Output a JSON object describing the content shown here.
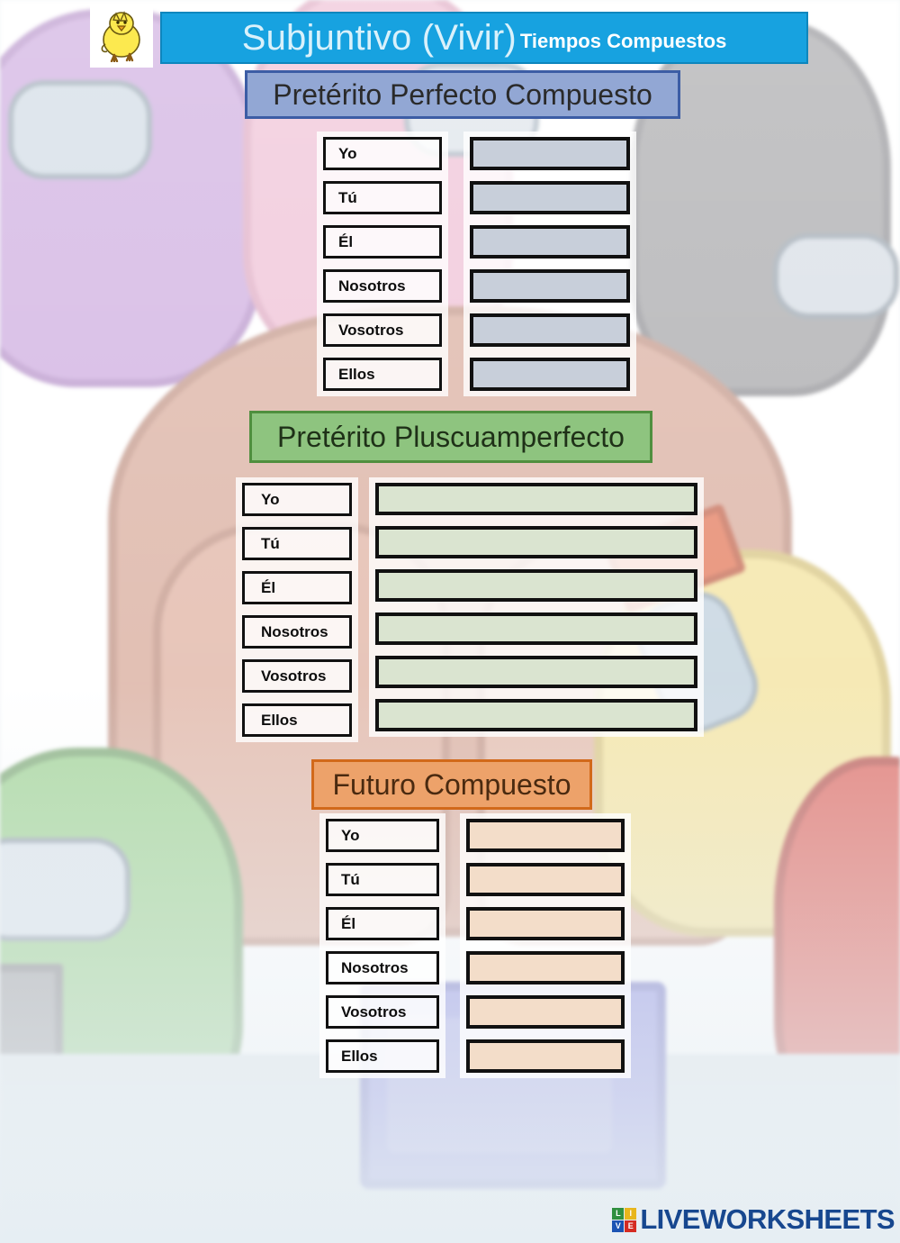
{
  "worksheet": {
    "mascot_icon": "chick-icon",
    "title_main": "Subjuntivo (Vivir)",
    "title_sub": "Tiempos Compuestos"
  },
  "sections": [
    {
      "id": "preterito-perfecto-compuesto",
      "heading": "Pretérito Perfecto Compuesto",
      "header_color": "#92a7d4",
      "header_border": "#3c5da5",
      "answer_fill": "#c8cfda",
      "rows": [
        {
          "pronoun": "Yo",
          "answer": ""
        },
        {
          "pronoun": "Tú",
          "answer": ""
        },
        {
          "pronoun": "Él",
          "answer": ""
        },
        {
          "pronoun": "Nosotros",
          "answer": ""
        },
        {
          "pronoun": "Vosotros",
          "answer": ""
        },
        {
          "pronoun": "Ellos",
          "answer": ""
        }
      ]
    },
    {
      "id": "preterito-pluscuamperfecto",
      "heading": "Pretérito Pluscuamperfecto",
      "header_color": "#8ec47f",
      "header_border": "#4f8f3e",
      "answer_fill": "#dae4d0",
      "rows": [
        {
          "pronoun": "Yo",
          "answer": ""
        },
        {
          "pronoun": "Tú",
          "answer": ""
        },
        {
          "pronoun": "Él",
          "answer": ""
        },
        {
          "pronoun": "Nosotros",
          "answer": ""
        },
        {
          "pronoun": "Vosotros",
          "answer": ""
        },
        {
          "pronoun": "Ellos",
          "answer": ""
        }
      ]
    },
    {
      "id": "futuro-compuesto",
      "heading": "Futuro Compuesto",
      "header_color": "#eda26a",
      "header_border": "#d2691a",
      "answer_fill": "#f3ddc9",
      "rows": [
        {
          "pronoun": "Yo",
          "answer": ""
        },
        {
          "pronoun": "Tú",
          "answer": ""
        },
        {
          "pronoun": "Él",
          "answer": ""
        },
        {
          "pronoun": "Nosotros",
          "answer": ""
        },
        {
          "pronoun": "Vosotros",
          "answer": ""
        },
        {
          "pronoun": "Ellos",
          "answer": ""
        }
      ]
    }
  ],
  "footer": {
    "logo_tiles": [
      "L",
      "I",
      "V",
      "E"
    ],
    "logo_word": "LIVEWORKSHEETS"
  }
}
